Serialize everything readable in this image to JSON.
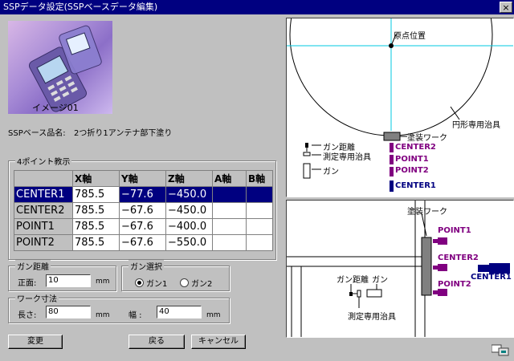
{
  "window": {
    "title": "SSPデータ設定(SSPベースデータ編集)",
    "close_label": "×"
  },
  "photo": {
    "caption": "イメージ01"
  },
  "ssp": {
    "label": "SSPベース品名:",
    "value": "2つ折り1アンテナ部下塗り"
  },
  "points": {
    "legend": "4ポイント教示",
    "columns": [
      "X軸",
      "Y軸",
      "Z軸",
      "A軸",
      "B軸"
    ],
    "rows": [
      {
        "name": "CENTER1",
        "x": "785.5",
        "y": "−77.6",
        "z": "−450.0",
        "a": "",
        "b": ""
      },
      {
        "name": "CENTER2",
        "x": "785.5",
        "y": "−67.6",
        "z": "−450.0",
        "a": "",
        "b": ""
      },
      {
        "name": "POINT1",
        "x": "785.5",
        "y": "−67.6",
        "z": "−400.0",
        "a": "",
        "b": ""
      },
      {
        "name": "POINT2",
        "x": "785.5",
        "y": "−67.6",
        "z": "−550.0",
        "a": "",
        "b": ""
      }
    ]
  },
  "gun_distance": {
    "legend": "ガン距離",
    "front_label": "正面:",
    "front_value": "10",
    "unit": "mm"
  },
  "gun_select": {
    "legend": "ガン選択",
    "options": [
      "ガン1",
      "ガン2"
    ],
    "selected": "ガン1"
  },
  "work_size": {
    "legend": "ワーク寸法",
    "length_label": "長さ:",
    "length_value": "80",
    "width_label": "幅 :",
    "width_value": "40",
    "unit": "mm"
  },
  "buttons": {
    "change": "変更",
    "back": "戻る",
    "cancel": "キャンセル"
  },
  "diagram_top": {
    "origin_label": "原点位置",
    "circle_label": "円形専用治具",
    "work_label": "塗装ワーク",
    "gun_distance_label": "ガン距離",
    "measure_jig_label": "測定専用治具",
    "gun_label": "ガン",
    "center2_label": "CENTER2",
    "point1_label": "POINT1",
    "point2_label": "POINT2",
    "center1_label": "CENTER1"
  },
  "diagram_bottom": {
    "work_label": "塗装ワーク",
    "point1_label": "POINT1",
    "center2_label": "CENTER2",
    "point2_label": "POINT2",
    "center1_label": "CENTER1",
    "gun_distance_label": "ガン距離",
    "gun_label": "ガン",
    "measure_jig_label": "測定専用治具"
  },
  "colors": {
    "purple": "#800080",
    "navy": "#000080",
    "cyan": "#00c8e0",
    "workgray": "#808080"
  }
}
